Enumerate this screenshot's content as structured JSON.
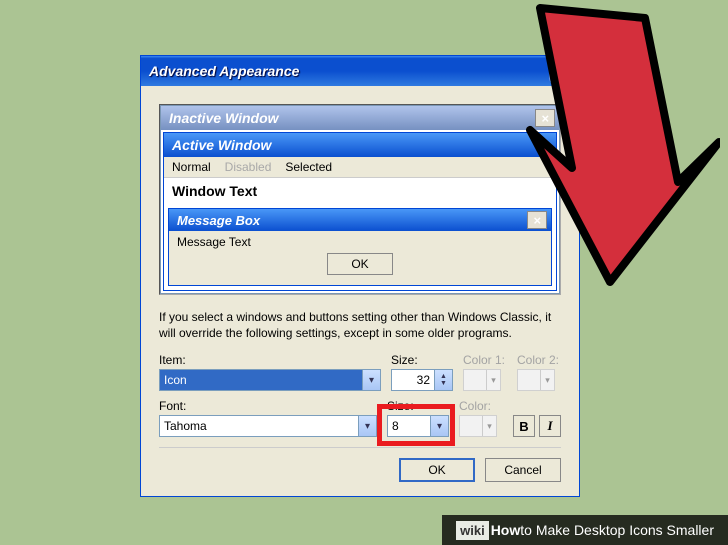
{
  "dialog": {
    "title": "Advanced Appearance",
    "help_label": "?"
  },
  "preview": {
    "inactive_title": "Inactive Window",
    "active_title": "Active Window",
    "menu_normal": "Normal",
    "menu_disabled": "Disabled",
    "menu_selected": "Selected",
    "window_text": "Window Text",
    "msgbox_title": "Message Box",
    "msgbox_text": "Message Text",
    "msgbox_ok": "OK",
    "close_x": "×"
  },
  "hint": "If you select a windows and buttons setting other than Windows Classic, it will override the following settings, except in some older programs.",
  "item": {
    "label": "Item:",
    "value": "Icon",
    "size_label": "Size:",
    "size_value": "32",
    "color1_label": "Color 1:",
    "color2_label": "Color 2:"
  },
  "font": {
    "label": "Font:",
    "value": "Tahoma",
    "size_label": "Size:",
    "size_value": "8",
    "color_label": "Color:",
    "bold_label": "B",
    "italic_label": "I"
  },
  "buttons": {
    "ok": "OK",
    "cancel": "Cancel"
  },
  "caption": {
    "wiki": "wiki",
    "how": "How",
    "rest": " to Make Desktop Icons Smaller"
  }
}
